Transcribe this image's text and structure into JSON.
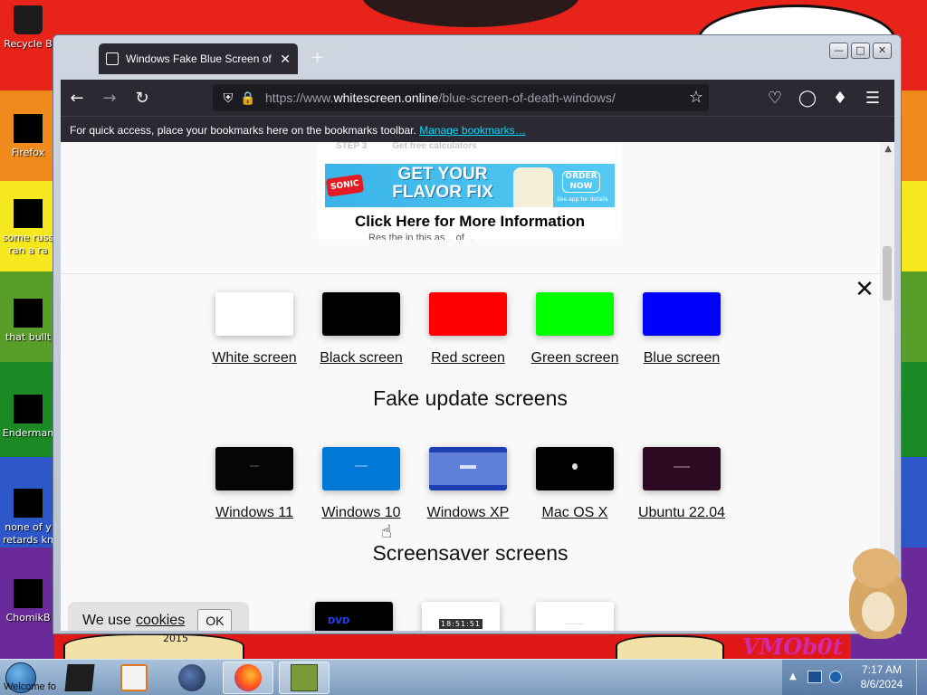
{
  "desktop": {
    "icons": [
      {
        "label": "Recycle B"
      },
      {
        "label": "Firefox"
      },
      {
        "label": "some russ",
        "label2": "ran a ra"
      },
      {
        "label": "that bullt"
      },
      {
        "label": "Enderman"
      },
      {
        "label": "none of y",
        "label2": "retards kn"
      },
      {
        "label": "ChomikB"
      }
    ],
    "wallpaper_mark": "VMOb0t",
    "wallpaper_year": "2015"
  },
  "browser": {
    "tab_title": "Windows Fake Blue Screen of D",
    "new_tab": "+",
    "url_prefix": "https://www.",
    "url_domain": "whitescreen.online",
    "url_path": "/blue-screen-of-death-windows/",
    "bookmarks_text": "For quick access, place your bookmarks here on the bookmarks toolbar.",
    "bookmarks_link": "Manage bookmarks…"
  },
  "ad": {
    "faded_step": "STEP 3",
    "faded_text": "Get free calculators",
    "brand": "SONIC",
    "headline": "GET YOUR FLAVOR FIX",
    "order": "ORDER NOW",
    "fine_print": "See app for details",
    "cta": "Click Here for More Information",
    "cut_text": "Res the in this as... of ..."
  },
  "colors": {
    "title": "",
    "tiles": [
      {
        "label": "White screen",
        "color": "#ffffff"
      },
      {
        "label": "Black screen",
        "color": "#000000"
      },
      {
        "label": "Red screen",
        "color": "#ff0000"
      },
      {
        "label": "Green screen",
        "color": "#00ff00"
      },
      {
        "label": "Blue screen",
        "color": "#0000ff"
      }
    ]
  },
  "update": {
    "heading": "Fake update screens",
    "tiles": [
      {
        "label": "Windows 11"
      },
      {
        "label": "Windows 10"
      },
      {
        "label": "Windows XP"
      },
      {
        "label": "Mac OS X"
      },
      {
        "label": "Ubuntu 22.04"
      }
    ]
  },
  "screensaver": {
    "heading": "Screensaver screens",
    "clock_text": "18:51:51"
  },
  "cookie": {
    "text": "We use",
    "link": "cookies",
    "ok": "OK"
  },
  "taskbar": {
    "start_label": "Welcome fo",
    "time": "7:17 AM",
    "date": "8/6/2024"
  }
}
